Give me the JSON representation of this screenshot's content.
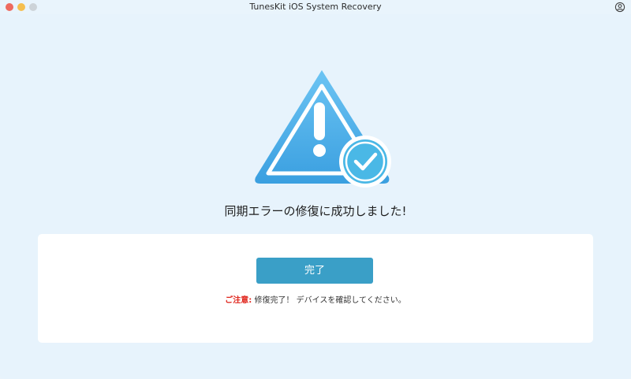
{
  "window": {
    "title": "TunesKit iOS System Recovery",
    "controls": [
      "close",
      "minimize",
      "maximize"
    ],
    "account_icon": "account-icon"
  },
  "hero": {
    "icon": "warning-triangle-with-checkmark-icon",
    "colors": {
      "triangle": "#4fb0ea",
      "check_circle": "#4ab8e6",
      "accent_dark": "#2d8fd1"
    }
  },
  "main": {
    "headline": "同期エラーの修復に成功しました!",
    "done_button": "完了",
    "note_label": "ご注意:",
    "note_text": " 修復完了！ デバイスを確認してください。"
  },
  "colors": {
    "background": "#e7f3fc",
    "button": "#3a9fc7",
    "note_label": "#e0241b"
  }
}
